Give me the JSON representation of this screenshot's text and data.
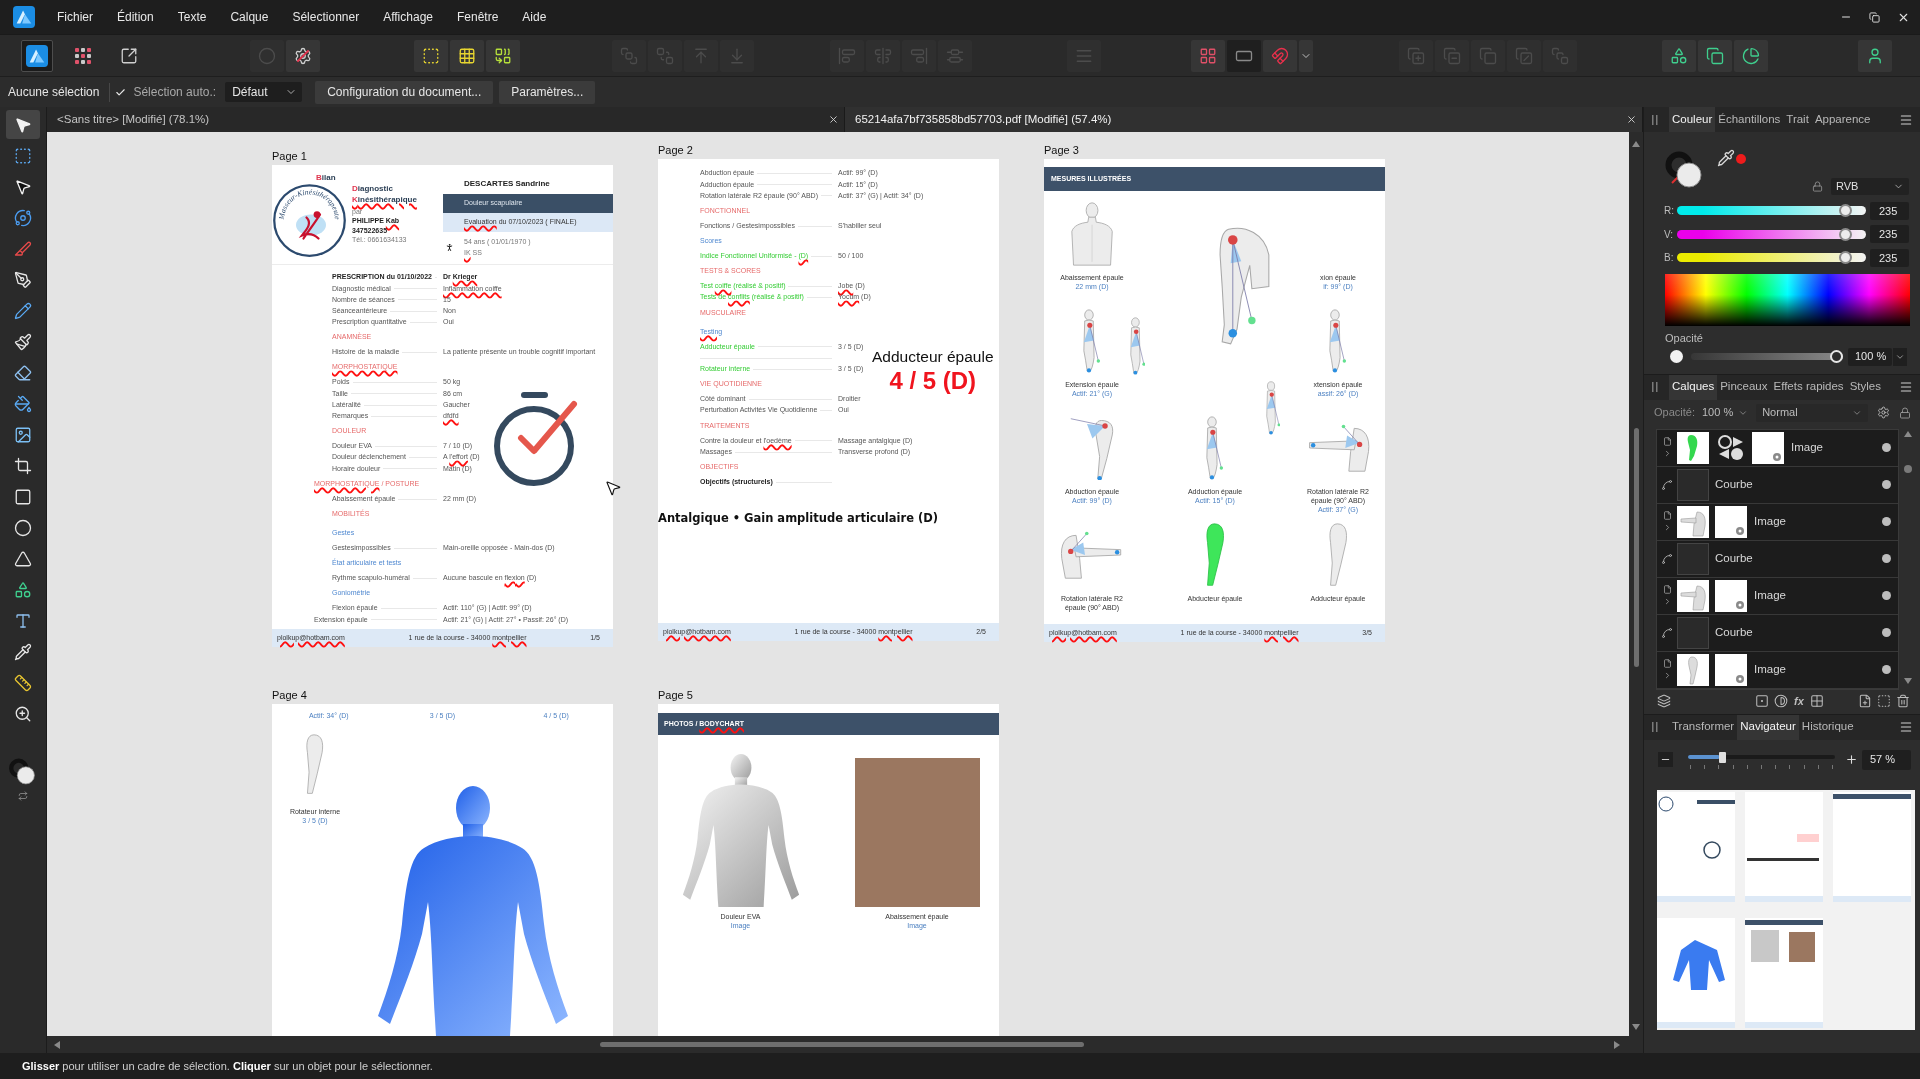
{
  "menu_bar": {
    "items": [
      "Fichier",
      "Édition",
      "Texte",
      "Calque",
      "Sélectionner",
      "Affichage",
      "Fenêtre",
      "Aide"
    ]
  },
  "toolbar": {
    "groups": [
      [
        {
          "kind": "publisher",
          "selected": true,
          "disabled": false
        },
        {
          "kind": "pixel",
          "selected": false,
          "disabled": false
        },
        {
          "kind": "export",
          "selected": false,
          "disabled": false
        }
      ],
      [
        {
          "kind": "dot",
          "disabled": true
        },
        {
          "kind": "preflight",
          "disabled": false
        }
      ],
      [
        {
          "kind": "frame-select",
          "disabled": false
        },
        {
          "kind": "frame-grid",
          "disabled": false
        },
        {
          "kind": "shape-link",
          "disabled": false
        }
      ],
      [
        {
          "kind": "bring-front",
          "disabled": true
        },
        {
          "kind": "send-back",
          "disabled": true
        },
        {
          "kind": "forward",
          "disabled": true
        },
        {
          "kind": "backward",
          "disabled": true
        }
      ],
      [
        {
          "kind": "align-left",
          "disabled": true
        },
        {
          "kind": "align-center",
          "disabled": true
        },
        {
          "kind": "align-right",
          "disabled": true
        },
        {
          "kind": "distribute",
          "disabled": true
        }
      ],
      [
        {
          "kind": "text-wrap",
          "disabled": true
        }
      ],
      [
        {
          "kind": "snap-grid",
          "disabled": false
        },
        {
          "kind": "snap-toggle",
          "disabled": false
        },
        {
          "kind": "magnet",
          "disabled": false
        },
        {
          "kind": "dropdown",
          "disabled": false
        }
      ],
      [
        {
          "kind": "union",
          "disabled": true
        },
        {
          "kind": "subtract",
          "disabled": true
        },
        {
          "kind": "intersect",
          "disabled": true
        },
        {
          "kind": "xor",
          "disabled": true
        },
        {
          "kind": "divide",
          "disabled": true
        }
      ],
      [
        {
          "kind": "insert-shape",
          "disabled": false
        },
        {
          "kind": "insert-frame",
          "disabled": false
        },
        {
          "kind": "chart",
          "disabled": false
        }
      ],
      [
        {
          "kind": "account",
          "disabled": false
        }
      ]
    ]
  },
  "context_bar": {
    "selection_label": "Aucune sélection",
    "auto_select": {
      "label": "Sélection auto.:",
      "checked": true
    },
    "auto_select_mode": "Défaut",
    "buttons": [
      "Configuration du document...",
      "Paramètres..."
    ]
  },
  "document_tabs": [
    {
      "title": "<Sans titre> [Modifié] (78.1%)",
      "selected": false
    },
    {
      "title": "65214afa7bf735858bd57703.pdf [Modifié] (57.4%)",
      "selected": true
    }
  ],
  "tools": [
    {
      "kind": "move",
      "selected": true
    },
    {
      "kind": "frame",
      "selected": false
    },
    {
      "kind": "node",
      "selected": false
    },
    {
      "kind": "transform",
      "selected": false
    },
    {
      "kind": "slice",
      "selected": false
    },
    {
      "kind": "pen",
      "selected": false
    },
    {
      "kind": "pencil",
      "selected": false
    },
    {
      "kind": "brush",
      "selected": false
    },
    {
      "kind": "eraser",
      "selected": false
    },
    {
      "kind": "fill",
      "selected": false
    },
    {
      "kind": "image",
      "selected": false
    },
    {
      "kind": "crop",
      "selected": false
    },
    {
      "kind": "rectangle",
      "selected": false
    },
    {
      "kind": "ellipse",
      "selected": false
    },
    {
      "kind": "triangle",
      "selected": false
    },
    {
      "kind": "shapes",
      "selected": false
    },
    {
      "kind": "text",
      "selected": false
    },
    {
      "kind": "picker",
      "selected": false
    },
    {
      "kind": "measure",
      "selected": false
    },
    {
      "kind": "zoom",
      "selected": false
    }
  ],
  "canvas": {
    "rows": [
      {
        "pages": [
          {
            "label": "Page 1",
            "kind": "report",
            "header": {
              "title_lines": [
                "Bilan",
                "Diagnostic",
                [
                  {
                    "text": "Kinésithérapique",
                    "flagged": true
                  }
                ]
              ],
              "logo_text": "Masseur-Kinésithérapeute",
              "author": {
                "intro": "par",
                "name": [
                  {
                    "text": "PHILIPPE ",
                    "flagged": false
                  },
                  {
                    "text": "Kab",
                    "flagged": true
                  }
                ],
                "id": "347522635",
                "phone": "Tél.: 0661634133"
              },
              "patient": {
                "name": "DESCARTES Sandrine",
                "reason": "Douleur scapulaire",
                "evaluation": [
                  {
                    "text": "Evaluation",
                    "flagged": true
                  },
                  {
                    "text": " du 07/10/2023 ( FINALE)",
                    "flagged": false
                  }
                ],
                "age": "54 ans ( 01/01/1970 )",
                "insurance": [
                  {
                    "text": "IK",
                    "flagged": true
                  },
                  {
                    "text": " SS",
                    "flagged": false
                  }
                ]
              }
            },
            "rows": [
              {
                "kind": "title-field",
                "label": "PRESCRIPTION du 01/10/2022",
                "value": [
                  {
                    "text": "Dr ",
                    "flagged": false
                  },
                  {
                    "text": "Krieger",
                    "flagged": true
                  }
                ]
              },
              {
                "kind": "field",
                "label": "Diagnostic médical",
                "value": [
                  {
                    "text": "Inflammation coiffe",
                    "flagged": true
                  }
                ]
              },
              {
                "kind": "field",
                "label": "Nombre de séances",
                "value": "15"
              },
              {
                "kind": "field",
                "label": "Séanceantérieure",
                "value": "Non"
              },
              {
                "kind": "field",
                "label": "Prescription quantitative",
                "value": "Oui"
              },
              {
                "kind": "section",
                "label": "ANAMNÈSE"
              },
              {
                "kind": "field",
                "label": "Histoire de la maladie",
                "value": "La patiente présente un trouble cognitif important"
              },
              {
                "kind": "section",
                "label": [
                  {
                    "text": "MORPHOSTATIQUE",
                    "flagged": true
                  }
                ]
              },
              {
                "kind": "field",
                "label": "Poids",
                "value": "50 kg"
              },
              {
                "kind": "field",
                "label": "Taille",
                "value": "86 cm"
              },
              {
                "kind": "field",
                "label": "Latéralité",
                "value": "Gaucher"
              },
              {
                "kind": "field",
                "label": "Remarques",
                "value": [
                  {
                    "text": "dfdfd",
                    "flagged": true
                  }
                ]
              },
              {
                "kind": "section",
                "label": "DOULEUR"
              },
              {
                "kind": "field",
                "label": "Douleur EVA",
                "value": "7 / 10 (D)"
              },
              {
                "kind": "field",
                "label": "Douleur déclenchement",
                "value": [
                  {
                    "text": "A ",
                    "flagged": false
                  },
                  {
                    "text": "l'effort",
                    "flagged": true
                  },
                  {
                    "text": " (D)",
                    "flagged": false
                  }
                ]
              },
              {
                "kind": "field",
                "label": "Horaire douleur",
                "value": "Matin (D)"
              },
              {
                "kind": "section-wide",
                "label": [
                  {
                    "text": "MORPHOSTATIQUE",
                    "flagged": true
                  },
                  {
                    "text": " / POSTURE",
                    "flagged": false
                  }
                ]
              },
              {
                "kind": "field",
                "label": "Abaissement épaule",
                "value": "22 mm (D)"
              },
              {
                "kind": "section",
                "label": "MOBILITÉS"
              },
              {
                "kind": "subsection",
                "label": "Gestes"
              },
              {
                "kind": "field",
                "label": "Gestesimpossibles",
                "value": "Main-oreille opposée - Main-dos (D)"
              },
              {
                "kind": "subsection",
                "label": "État articulaire et tests"
              },
              {
                "kind": "field",
                "label": "Rythme scapulo-huméral",
                "value": [
                  {
                    "text": "Aucune bascule en ",
                    "flagged": false
                  },
                  {
                    "text": "flexion",
                    "flagged": true
                  },
                  {
                    "text": " (D)",
                    "flagged": false
                  }
                ]
              },
              {
                "kind": "subsection",
                "label": "Goniométrie"
              },
              {
                "kind": "field",
                "label": "Flexion épaule",
                "value": "Actif: 110° (G) | Actif: 99° (D)"
              },
              {
                "kind": "field-wide",
                "label": "Extension épaule",
                "value": "Actif: 21° (G) | Actif: 27° • Passif: 26° (D)"
              }
            ],
            "footer": {
              "email": [
                {
                  "text": "plolkup@hotbam.com",
                  "flagged": true
                }
              ],
              "address": [
                {
                  "text": "1 rue de la course - 34000 ",
                  "flagged": false
                },
                {
                  "text": "montpellier",
                  "flagged": true
                }
              ],
              "page_number": "1/5"
            },
            "overlays": [
              {
                "kind": "stopwatch"
              }
            ]
          },
          {
            "label": "Page 2",
            "kind": "report-continued",
            "rows": [
              {
                "kind": "field",
                "label": "Abduction épaule",
                "value": "Actif: 99° (D)"
              },
              {
                "kind": "field",
                "label": "Adduction épaule",
                "value": "Actif: 15° (D)"
              },
              {
                "kind": "field",
                "label": "Rotation latérale R2 épaule (90° ABD)",
                "value": "Actif: 37° (G) | Actif: 34° (D)"
              },
              {
                "kind": "section",
                "label": "FONCTIONNEL"
              },
              {
                "kind": "field",
                "label": "Fonctions / Gestesimpossibles",
                "value": "S'habiller seul"
              },
              {
                "kind": "subsection",
                "label": "Scores"
              },
              {
                "kind": "accent-field",
                "label": [
                  {
                    "text": "Indice Fonctionnel Uniformisé - ",
                    "flagged": false
                  },
                  {
                    "text": "(D)",
                    "flagged": true
                  }
                ],
                "value": "50 / 100"
              },
              {
                "kind": "section",
                "label": "TESTS & SCORES"
              },
              {
                "kind": "accent-field",
                "label": [
                  {
                    "text": "Test ",
                    "flagged": false
                  },
                  {
                    "text": "coiffe",
                    "flagged": true
                  },
                  {
                    "text": " (réalisé & positif)",
                    "flagged": false
                  }
                ],
                "value": [
                  {
                    "text": "Jobe",
                    "flagged": true
                  },
                  {
                    "text": " (D)",
                    "flagged": false
                  }
                ]
              },
              {
                "kind": "accent-field",
                "label": [
                  {
                    "text": "Tests de ",
                    "flagged": false
                  },
                  {
                    "text": "conflits",
                    "flagged": true
                  },
                  {
                    "text": " (réalisé & positif)",
                    "flagged": false
                  }
                ],
                "value": [
                  {
                    "text": "Yocum",
                    "flagged": true
                  },
                  {
                    "text": " (D)",
                    "flagged": false
                  }
                ]
              },
              {
                "kind": "section",
                "label": "MUSCULAIRE"
              },
              {
                "kind": "subsection",
                "label": [
                  {
                    "text": "Testing",
                    "flagged": true
                  }
                ]
              },
              {
                "kind": "accent-field",
                "label": "Adducteur épaule",
                "value": "3 / 5 (D)"
              },
              {
                "kind": "leader"
              },
              {
                "kind": "accent-field",
                "label": "Rotateur interne",
                "value": "3 / 5 (D)"
              },
              {
                "kind": "section",
                "label": "VIE QUOTIDIENNE"
              },
              {
                "kind": "field",
                "label": "Côté dominant",
                "value": "Droitier"
              },
              {
                "kind": "field",
                "label": "Perturbation Activités Vie Quotidienne",
                "value": "Oui"
              },
              {
                "kind": "section",
                "label": "TRAITEMENTS"
              },
              {
                "kind": "field",
                "label": [
                  {
                    "text": "Contre la douleur et ",
                    "flagged": false
                  },
                  {
                    "text": "l'oedème",
                    "flagged": true
                  }
                ],
                "value": "Massage antalgique (D)"
              },
              {
                "kind": "field",
                "label": "Massages",
                "value": "Transverse profond (D)"
              },
              {
                "kind": "section",
                "label": "OBJECTIFS"
              },
              {
                "kind": "title-field",
                "label": "Objectifs (structurels)"
              }
            ],
            "footer": {
              "email": [
                {
                  "text": "plolkup@hotbam.com",
                  "flagged": true
                }
              ],
              "address": [
                {
                  "text": "1 rue de la course - 34000 ",
                  "flagged": false
                },
                {
                  "text": "montpellier",
                  "flagged": true
                }
              ],
              "page_number": "2/5"
            },
            "overlays": [
              {
                "kind": "score-callout",
                "title": "Adducteur épaule",
                "score": "4 / 5 (D)"
              },
              {
                "kind": "banner",
                "text": "Antalgique • Gain amplitude articulaire (D)"
              }
            ]
          },
          {
            "label": "Page 3",
            "kind": "figures",
            "header": "MESURES ILLUSTRÉES",
            "figures": [
              {
                "kind": "back",
                "caption": "Abaissement épaule",
                "measure": "22 mm (D)"
              },
              {
                "kind": "large"
              },
              {
                "kind": "none",
                "caption": "xion épaule",
                "measure": "if: 99° (D)"
              },
              {
                "kind": "standing",
                "caption": "Extension épaule",
                "measure": "Actif: 21° (G)"
              },
              {
                "kind": "standing",
                "caption": "xtension épaule",
                "measure": "assif: 26° (D)"
              },
              {
                "kind": "abduction",
                "caption": "Abduction épaule",
                "measure": "Actif: 99° (D)"
              },
              {
                "kind": "standing",
                "caption": "Adduction épaule",
                "measure": "Actif: 15° (D)"
              },
              {
                "kind": "forward",
                "caption": "Rotation latérale R2 épaule (90° ABD)",
                "measure": "Actif: 37° (G)"
              },
              {
                "kind": "forward-left",
                "caption": "Rotation latérale R2 épaule (90° ABD)"
              },
              {
                "kind": "green",
                "caption": "Abducteur épaule"
              },
              {
                "kind": "plain",
                "caption": "Adducteur épaule"
              }
            ],
            "footer": {
              "email": [
                {
                  "text": "plolkup@hotbam.com",
                  "flagged": true
                }
              ],
              "address": [
                {
                  "text": "1 rue de la course - 34000 ",
                  "flagged": false
                },
                {
                  "text": "montpellier",
                  "flagged": true
                }
              ],
              "page_number": "3/5"
            }
          }
        ]
      },
      {
        "pages": [
          {
            "label": "Page 4",
            "kind": "body-chart",
            "measures": [
              "Actif: 34° (D)",
              "3 / 5 (D)",
              "4 / 5 (D)"
            ],
            "figure": {
              "kind": "plain",
              "caption": "Rotateur interne",
              "measure": "3 / 5 (D)"
            }
          },
          {
            "label": "Page 5",
            "kind": "photos",
            "header": [
              {
                "text": "PHOTOS / ",
                "flagged": false
              },
              {
                "text": "BODYCHART",
                "flagged": true
              }
            ],
            "photos": [
              {
                "kind": "torso",
                "caption": "Douleur EVA",
                "link": "Image"
              },
              {
                "kind": "photo",
                "caption": "Abaissement épaule",
                "link": "Image"
              }
            ]
          }
        ]
      }
    ]
  },
  "color_panel": {
    "tabs": [
      {
        "label": "Couleur",
        "selected": true
      },
      {
        "label": "Échantillons",
        "selected": false
      },
      {
        "label": "Trait",
        "selected": false
      },
      {
        "label": "Apparence",
        "selected": false
      }
    ],
    "model": "RVB",
    "channels": [
      {
        "label": "R:",
        "color": "#00ebeb",
        "level": 0.92,
        "value": "235"
      },
      {
        "label": "V:",
        "color": "#eb00eb",
        "level": 0.92,
        "value": "235"
      },
      {
        "label": "B:",
        "color": "#ebeb00",
        "level": 0.92,
        "value": "235"
      }
    ],
    "opacity": {
      "label": "Opacité",
      "level": 1,
      "value": "100 %"
    }
  },
  "layers_panel": {
    "tabs": [
      {
        "label": "Calques",
        "selected": true
      },
      {
        "label": "Pinceaux",
        "selected": false
      },
      {
        "label": "Effets rapides",
        "selected": false
      },
      {
        "label": "Styles",
        "selected": false
      }
    ],
    "opacity_label": "Opacité:",
    "opacity_value": "100 %",
    "blend_mode": "Normal",
    "layers": [
      {
        "kind": "image",
        "name": "Image",
        "thumbnail": {
          "kind": "arm-green"
        },
        "adjustment": true,
        "visible": true
      },
      {
        "kind": "curve",
        "name": "Courbe",
        "visible": true
      },
      {
        "kind": "image",
        "name": "Image",
        "thumbnail": {
          "kind": "arm-raised"
        },
        "adjustment": false,
        "visible": true
      },
      {
        "kind": "curve",
        "name": "Courbe",
        "visible": true
      },
      {
        "kind": "image",
        "name": "Image",
        "thumbnail": {
          "kind": "arm-raised"
        },
        "adjustment": false,
        "visible": true
      },
      {
        "kind": "curve",
        "name": "Courbe",
        "visible": true
      },
      {
        "kind": "image",
        "name": "Image",
        "thumbnail": {
          "kind": "arm-standing"
        },
        "adjustment": false,
        "visible": true
      }
    ],
    "effects_label": "fx"
  },
  "navigator_panel": {
    "tabs": [
      {
        "label": "Transformer",
        "selected": false
      },
      {
        "label": "Navigateur",
        "selected": true
      },
      {
        "label": "Historique",
        "selected": false
      }
    ],
    "zoom": {
      "level": 0.22,
      "value": "57 %"
    }
  },
  "status_bar": {
    "hint": "**Glisser** pour utiliser un cadre de sélection. **Cliquer** sur un objet pour le sélectionner."
  }
}
